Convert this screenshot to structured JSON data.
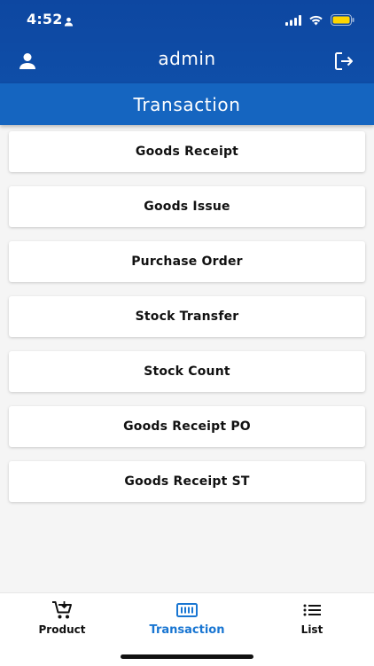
{
  "status_bar": {
    "time": "4:52"
  },
  "app_bar": {
    "title": "admin"
  },
  "section": {
    "title": "Transaction"
  },
  "menu": [
    {
      "label": "Goods Receipt"
    },
    {
      "label": "Goods Issue"
    },
    {
      "label": "Purchase Order"
    },
    {
      "label": "Stock Transfer"
    },
    {
      "label": "Stock Count"
    },
    {
      "label": "Goods Receipt PO"
    },
    {
      "label": "Goods Receipt ST"
    }
  ],
  "bottom_nav": [
    {
      "label": "Product",
      "icon": "cart-icon",
      "active": false
    },
    {
      "label": "Transaction",
      "icon": "barcode-icon",
      "active": true
    },
    {
      "label": "List",
      "icon": "list-icon",
      "active": false
    }
  ],
  "colors": {
    "primary_dark": "#0d47a1",
    "primary": "#1565c0",
    "active_tab": "#1976d2"
  }
}
